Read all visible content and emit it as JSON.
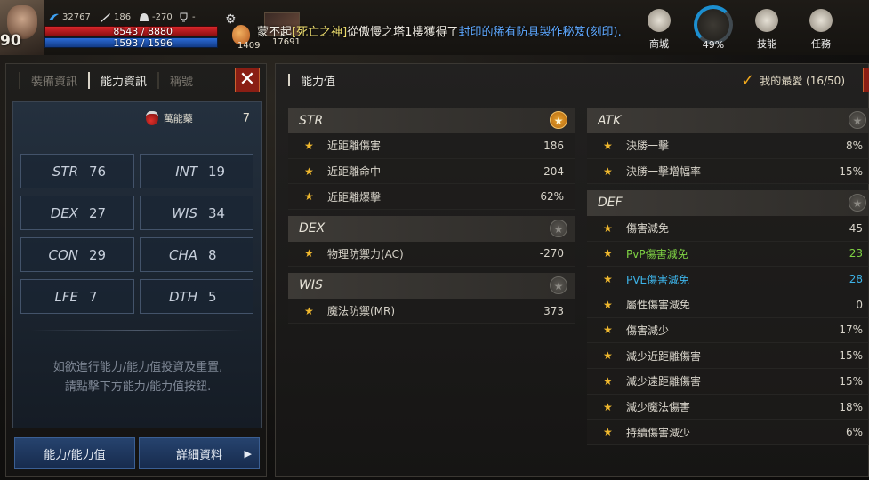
{
  "hud": {
    "level": "90",
    "currency": "32767",
    "stat2": "186",
    "stat3": "-270",
    "stat4": "-",
    "hp": "8543 / 8880",
    "mp": "1593 / 1596",
    "buff_count": "1409",
    "skill_count": "17691",
    "chat": {
      "prefix": "蒙不起",
      "player": "[死亡之神]",
      "mid": "從傲慢之塔1樓獲得了",
      "item": "封印的稀有防具製作秘笈(刻印)."
    },
    "buttons": [
      {
        "label": "商城",
        "icon": "shop-icon"
      },
      {
        "label": "技能",
        "icon": "skill-icon"
      },
      {
        "label": "任務",
        "icon": "quest-icon"
      }
    ],
    "progress_pct": "49%",
    "progress_value": 0.49
  },
  "left": {
    "tabs": [
      "裝備資訊",
      "能力資訊",
      "稱號"
    ],
    "active_tab": 1,
    "elixir_label": "萬能藥",
    "elixir_value": "7",
    "stats": [
      {
        "name": "STR",
        "value": "76"
      },
      {
        "name": "INT",
        "value": "19"
      },
      {
        "name": "DEX",
        "value": "27"
      },
      {
        "name": "WIS",
        "value": "34"
      },
      {
        "name": "CON",
        "value": "29"
      },
      {
        "name": "CHA",
        "value": "8"
      },
      {
        "name": "LFE",
        "value": "7"
      },
      {
        "name": "DTH",
        "value": "5"
      }
    ],
    "hint_line1": "如欲進行能力/能力值投資及重置,",
    "hint_line2": "請點擊下方能力/能力值按鈕.",
    "btn_ability": "能力/能力值",
    "btn_detail": "詳細資料"
  },
  "right": {
    "title": "能力值",
    "favorites": "我的最愛 (16/50)",
    "left_sections": [
      {
        "name": "STR",
        "starred": true,
        "rows": [
          {
            "label": "近距離傷害",
            "value": "186"
          },
          {
            "label": "近距離命中",
            "value": "204"
          },
          {
            "label": "近距離爆擊",
            "value": "62%"
          }
        ]
      },
      {
        "name": "DEX",
        "starred": false,
        "rows": [
          {
            "label": "物理防禦力(AC)",
            "value": "-270"
          }
        ]
      },
      {
        "name": "WIS",
        "starred": false,
        "rows": [
          {
            "label": "魔法防禦(MR)",
            "value": "373"
          }
        ]
      }
    ],
    "right_sections": [
      {
        "name": "ATK",
        "starred": false,
        "rows": [
          {
            "label": "決勝一擊",
            "value": "8%"
          },
          {
            "label": "決勝一擊增幅率",
            "value": "15%"
          }
        ]
      },
      {
        "name": "DEF",
        "starred": false,
        "rows": [
          {
            "label": "傷害減免",
            "value": "45"
          },
          {
            "label": "PvP傷害減免",
            "value": "23",
            "color": "green"
          },
          {
            "label": "PVE傷害減免",
            "value": "28",
            "color": "cyan"
          },
          {
            "label": "屬性傷害減免",
            "value": "0"
          },
          {
            "label": "傷害減少",
            "value": "17%"
          },
          {
            "label": "減少近距離傷害",
            "value": "15%"
          },
          {
            "label": "減少遠距離傷害",
            "value": "15%"
          },
          {
            "label": "減少魔法傷害",
            "value": "18%"
          },
          {
            "label": "持續傷害減少",
            "value": "6%"
          }
        ]
      }
    ]
  }
}
